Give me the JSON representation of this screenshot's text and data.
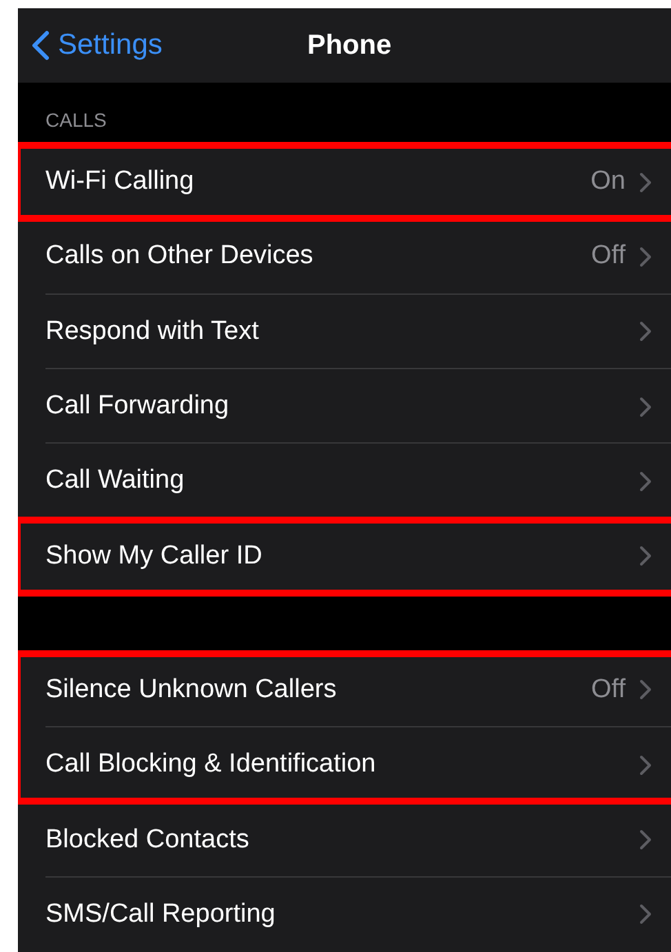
{
  "nav": {
    "back_label": "Settings",
    "title": "Phone"
  },
  "sections": [
    {
      "header": "CALLS",
      "rows": [
        {
          "label": "Wi-Fi Calling",
          "value": "On",
          "highlighted": true
        },
        {
          "label": "Calls on Other Devices",
          "value": "Off",
          "highlighted": false
        },
        {
          "label": "Respond with Text",
          "highlighted": false
        },
        {
          "label": "Call Forwarding",
          "highlighted": false
        },
        {
          "label": "Call Waiting",
          "highlighted": false
        },
        {
          "label": "Show My Caller ID",
          "highlighted": true
        }
      ]
    },
    {
      "rows": [
        {
          "label": "Silence Unknown Callers",
          "value": "Off",
          "highlighted": true
        },
        {
          "label": "Call Blocking & Identification",
          "highlighted": true
        },
        {
          "label": "Blocked Contacts",
          "highlighted": false
        },
        {
          "label": "SMS/Call Reporting",
          "highlighted": false
        }
      ]
    }
  ]
}
